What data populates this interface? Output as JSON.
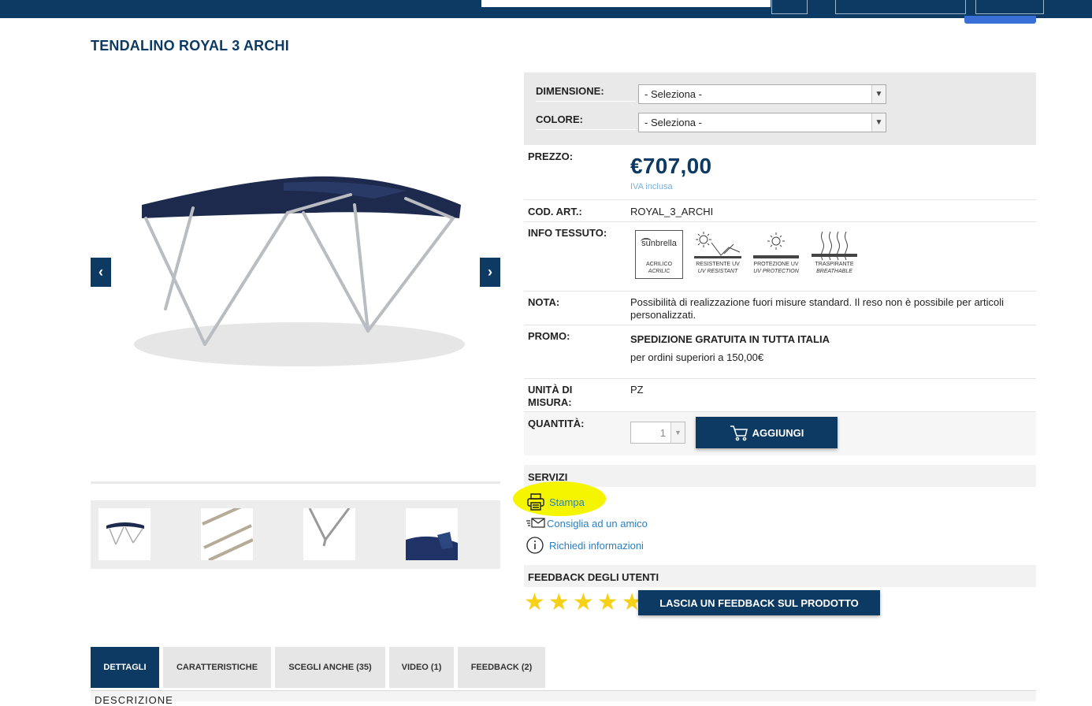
{
  "product": {
    "title": "TENDALINO ROYAL 3 ARCHI",
    "price": "€707,00",
    "vat_note": "IVA inclusa",
    "code_label": "COD. ART.:",
    "code": "ROYAL_3_ARCHI",
    "fabric_label": "INFO TESSUTO:",
    "note_label": "NOTA:",
    "note": "Possibilità di realizzazione fuori misure standard. Il reso non è possibile per articoli personalizzati.",
    "promo_label": "PROMO:",
    "promo_title": "SPEDIZIONE GRATUITA IN TUTTA ITALIA",
    "promo_sub": "per ordini superiori a 150,00€",
    "unit_label": "UNITÀ DI MISURA:",
    "unit": "PZ",
    "qty_label": "QUANTITÀ:",
    "qty": "1",
    "price_label": "PREZZO:"
  },
  "options": {
    "size_label": "DIMENSIONE:",
    "size_value": "- Seleziona -",
    "color_label": "COLORE:",
    "color_value": "- Seleziona -"
  },
  "fabric_badges": [
    {
      "logo": "sunbrella",
      "line1": "ACRILICO",
      "line2": "ACRILIC"
    },
    {
      "line1": "RESISTENTE UV",
      "line2": "UV RESISTANT"
    },
    {
      "line1": "PROTEZIONE UV",
      "line2": "UV PROTECTION"
    },
    {
      "line1": "TRASPIRANTE",
      "line2": "BREATHABLE"
    }
  ],
  "buttons": {
    "add_to_cart": "AGGIUNGI",
    "leave_feedback": "LASCIA UN FEEDBACK SUL PRODOTTO"
  },
  "services": {
    "title": "SERVIZI",
    "print": "Stampa",
    "recommend": "Consiglia ad un amico",
    "info": "Richiedi informazioni"
  },
  "feedback": {
    "title": "FEEDBACK DEGLI UTENTI",
    "rating": 5,
    "max": 5
  },
  "tabs": [
    "DETTAGLI",
    "CARATTERISTICHE",
    "SCEGLI ANCHE (35)",
    "VIDEO (1)",
    "FEEDBACK (2)"
  ],
  "description_heading": "DESCRIZIONE",
  "colors": {
    "brand": "#0c3a63",
    "star": "#f7d117",
    "link": "#2a7fc2",
    "highlight": "#f5f500"
  },
  "icons": {
    "prev": "chevron-left-icon",
    "next": "chevron-right-icon",
    "cart": "cart-icon",
    "print": "printer-icon",
    "mail": "mail-icon",
    "info": "info-icon"
  }
}
